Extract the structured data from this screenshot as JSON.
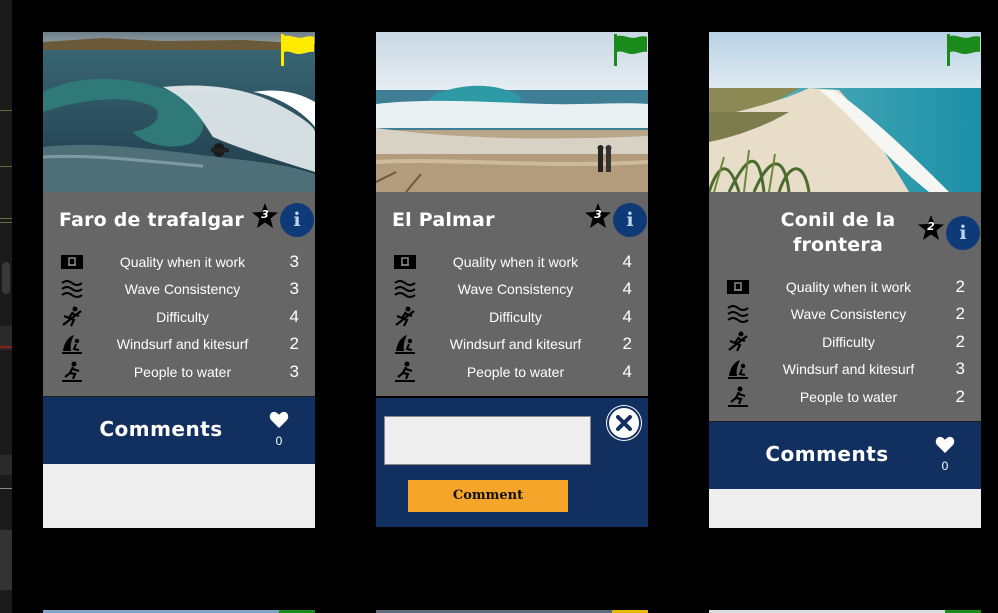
{
  "stat_labels": {
    "quality": "Quality when it work",
    "consistency": "Wave Consistency",
    "difficulty": "Difficulty",
    "windsurf": "Windsurf and kitesurf",
    "people": "People to water"
  },
  "icons": [
    "quality-icon",
    "wave-icon",
    "difficulty-icon",
    "windsurf-icon",
    "people-icon",
    "flag-icon",
    "star-rank-icon",
    "info-icon",
    "heart-icon",
    "close-icon"
  ],
  "colors": {
    "flag_yellow": "#ffeb00",
    "flag_green": "#1a8a1a",
    "info_button": "#0f3a78",
    "comments_bar": "#12305f",
    "submit_button": "#f5a529",
    "card_info_bg": "#666666"
  },
  "cards": [
    {
      "title": "Faro de trafalgar",
      "rank": "3",
      "flag": "yellow",
      "stats": {
        "quality": "3",
        "consistency": "3",
        "difficulty": "4",
        "windsurf": "2",
        "people": "3"
      },
      "comments_label": "Comments",
      "likes": "0"
    },
    {
      "title": "El Palmar",
      "rank": "3",
      "flag": "green",
      "stats": {
        "quality": "4",
        "consistency": "4",
        "difficulty": "4",
        "windsurf": "2",
        "people": "4"
      },
      "comment_input": {
        "value": "",
        "placeholder": ""
      },
      "submit_label": "Comment"
    },
    {
      "title": "Conil de la frontera",
      "rank": "2",
      "flag": "green",
      "stats": {
        "quality": "2",
        "consistency": "2",
        "difficulty": "2",
        "windsurf": "3",
        "people": "2"
      },
      "comments_label": "Comments",
      "likes": "0"
    }
  ]
}
